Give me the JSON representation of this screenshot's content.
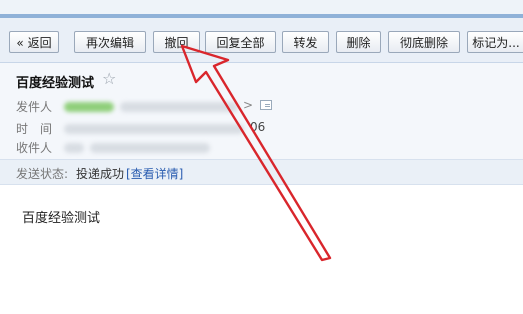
{
  "toolbar": {
    "buttons": [
      {
        "id": "back",
        "label": "« 返回"
      },
      {
        "id": "reedit",
        "label": "再次编辑"
      },
      {
        "id": "recall",
        "label": "撤回"
      },
      {
        "id": "reply_all",
        "label": "回复全部"
      },
      {
        "id": "forward",
        "label": "转发"
      },
      {
        "id": "delete",
        "label": "删除"
      },
      {
        "id": "delete_permanent",
        "label": "彻底删除"
      },
      {
        "id": "mark_as",
        "label": "标记为..."
      }
    ]
  },
  "mail": {
    "subject": "百度经验测试",
    "star_icon": "star-outline-icon",
    "sender_label": "发件人",
    "time_label": "时　间",
    "time_tail": "06",
    "recipient_label": "收件人",
    "status_label": "发送状态:",
    "status_value": "投递成功",
    "status_link": "[查看详情]",
    "body": "百度经验测试"
  },
  "annotation": {
    "color": "#d9262c",
    "icon": "red-arrow-pointing-to-recall-button"
  }
}
